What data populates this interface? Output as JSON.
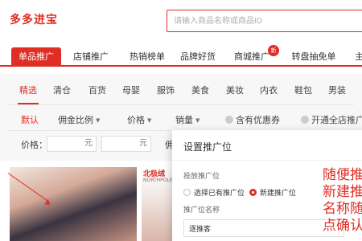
{
  "header": {
    "logo": "多多进宝",
    "search_placeholder": "请输入商品名称或商品ID"
  },
  "nav": {
    "tabs": [
      "单品推广",
      "店铺推广",
      "热销榜单",
      "品牌好货",
      "商城推广",
      "转盘抽免单",
      "主题"
    ],
    "active": "单品推广",
    "badge": "新"
  },
  "categories": {
    "items": [
      "精选",
      "清仓",
      "百货",
      "母婴",
      "服饰",
      "美食",
      "美妆",
      "内衣",
      "鞋包",
      "男装"
    ],
    "active": "精选"
  },
  "sort": {
    "default": "默认",
    "commission": "佣金比例",
    "price": "价格",
    "sales": "销量",
    "coupon": "含有优惠券",
    "store": "开通全店推广"
  },
  "price_filter": {
    "label": "价格：",
    "unit_min": "元",
    "unit_max": "元",
    "extra": "佣"
  },
  "product": {
    "tag": "北极绒",
    "subtag": "NORTHPOLE"
  },
  "modal": {
    "title": "设置推广位",
    "position_label": "投放推广位",
    "option_existing": "选择已有推广位",
    "option_new": "新建推广位",
    "name_label": "推广位名称",
    "name_value": "逐推客"
  },
  "annotation": {
    "lines": [
      "随便推",
      "新建推",
      "名称随",
      "点确认"
    ]
  },
  "colors": {
    "accent": "#e02e24"
  }
}
